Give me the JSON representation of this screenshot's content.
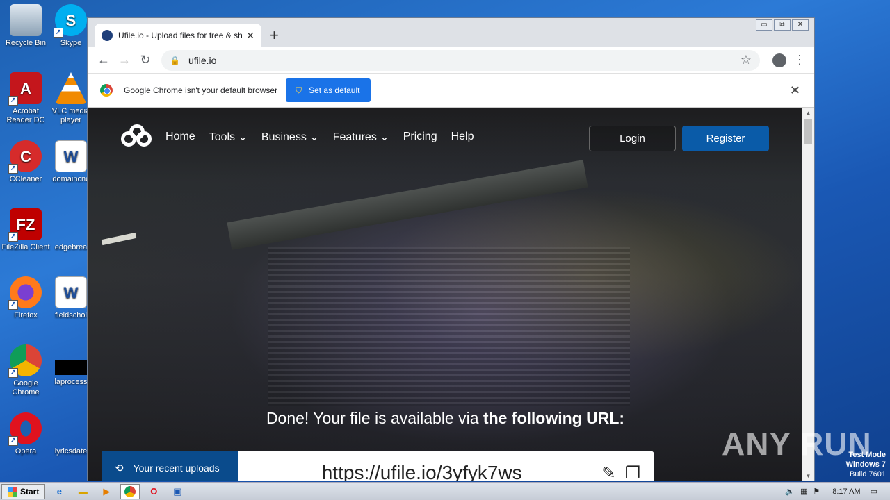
{
  "desktop": {
    "icons": [
      {
        "label": "Recycle Bin"
      },
      {
        "label": "Skype"
      },
      {
        "label": "Acrobat Reader DC"
      },
      {
        "label": "VLC media player"
      },
      {
        "label": "CCleaner"
      },
      {
        "label": "domaincnc"
      },
      {
        "label": "FileZilla Client"
      },
      {
        "label": "edgebrea"
      },
      {
        "label": "Firefox"
      },
      {
        "label": "fieldschoi"
      },
      {
        "label": "Google Chrome"
      },
      {
        "label": "laprocess"
      },
      {
        "label": "Opera"
      },
      {
        "label": "lyricsdate"
      }
    ],
    "watermark": "ANY RUN",
    "test_mode": {
      "line1": "Test Mode",
      "line2": "Windows 7",
      "line3": "Build 7601"
    }
  },
  "browser": {
    "tab_title": "Ufile.io - Upload files for free & share",
    "window_controls": [
      "▭",
      "⧉",
      "✕"
    ],
    "address": "ufile.io",
    "infobar": {
      "message": "Google Chrome isn't your default browser",
      "button": "Set as default"
    }
  },
  "site": {
    "nav": [
      "Home",
      "Tools",
      "Business",
      "Features",
      "Pricing",
      "Help"
    ],
    "login": "Login",
    "register": "Register",
    "done_text_plain": "Done! Your file is available via ",
    "done_text_strong": "the following URL:",
    "recent_uploads": "Your recent uploads",
    "file_url": "https://ufile.io/3yfyk7ws"
  },
  "taskbar": {
    "start": "Start",
    "clock": "8:17 AM"
  }
}
